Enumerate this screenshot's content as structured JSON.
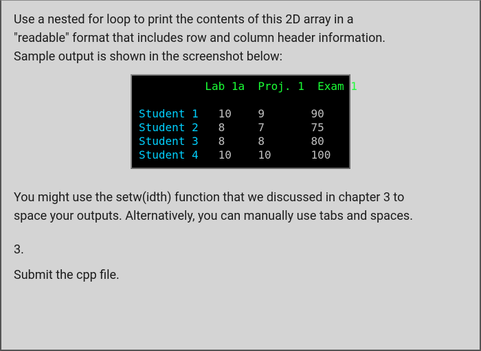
{
  "intro": {
    "line1": "Use a nested for loop to print the contents of this 2D array in a",
    "line2": "\"readable\" format that includes row and column header information.",
    "line3": "Sample output is shown in the screenshot below:"
  },
  "terminal": {
    "header": {
      "pad": "          ",
      "c1": "Lab 1a",
      "c2": "Proj. 1",
      "c3": "Exam 1"
    },
    "rows": [
      {
        "label": "Student 1",
        "v1": "10",
        "v2": "9",
        "v3": "90"
      },
      {
        "label": "Student 2",
        "v1": "8",
        "v2": "7",
        "v3": "75"
      },
      {
        "label": "Student 3",
        "v1": "8",
        "v2": "8",
        "v3": "80"
      },
      {
        "label": "Student 4",
        "v1": "10",
        "v2": "10",
        "v3": "100"
      }
    ]
  },
  "note": {
    "line1": "You might use the setw(idth) function that we discussed in chapter 3 to",
    "line2": "space your outputs. Alternatively, you can manually use tabs and spaces."
  },
  "q3_number": "3.",
  "submit": "Submit the cpp file."
}
